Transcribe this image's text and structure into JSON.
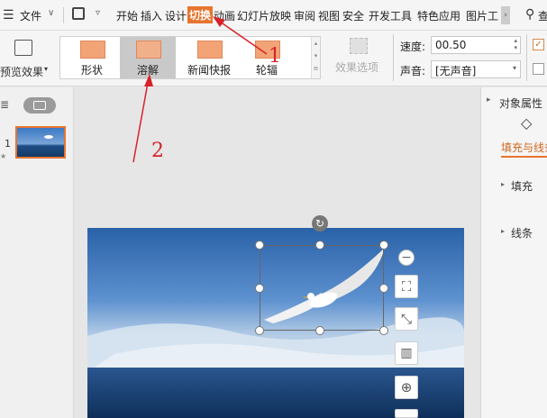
{
  "menubar": {
    "file_label": "文件",
    "tabs": [
      "开始",
      "插入",
      "设计",
      "切换",
      "动画",
      "幻灯片放映",
      "审阅",
      "视图",
      "安全",
      "开发工具",
      "特色应用",
      "图片工"
    ],
    "active_tab": "切换",
    "search_label": "查"
  },
  "ribbon": {
    "preview_label": "预览效果",
    "transitions": [
      {
        "label": "形状"
      },
      {
        "label": "溶解"
      },
      {
        "label": "新闻快报"
      },
      {
        "label": "轮辐"
      }
    ],
    "effect_options_label": "效果选项",
    "speed_label": "速度:",
    "speed_value": "00.50",
    "sound_label": "声音:",
    "sound_value": "[无声音]"
  },
  "slides_panel": {
    "slide_number": "1",
    "star": "★"
  },
  "right_panel": {
    "title": "对象属性",
    "tab_fill_line": "填充与线条",
    "section_fill": "填充",
    "section_line": "线条"
  },
  "annotations": {
    "step1": "1",
    "step2": "2"
  },
  "colors": {
    "accent": "#e8742f",
    "annotation": "#d6232a",
    "sky_top": "#2a62a8",
    "sea": "#173d6e"
  }
}
